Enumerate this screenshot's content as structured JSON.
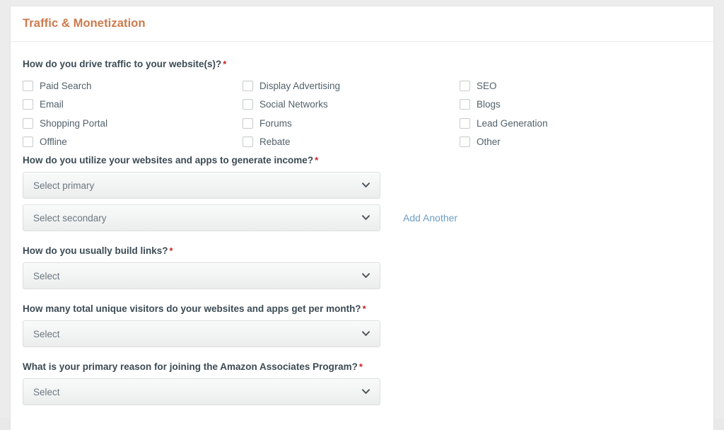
{
  "card": {
    "title": "Traffic & Monetization"
  },
  "colors": {
    "title": "#cc7a4c",
    "label": "#3c4b54",
    "required": "#cc2121",
    "link": "#6d9dc3",
    "select_text": "#6b7880",
    "page_background": "#ececed",
    "card_background": "#ffffff"
  },
  "required_marker": "*",
  "fields": {
    "traffic": {
      "label": "How do you drive traffic to your website(s)?",
      "required": true,
      "type": "checkbox-group",
      "columns": [
        [
          {
            "label": "Paid Search",
            "checked": false
          },
          {
            "label": "Email",
            "checked": false
          },
          {
            "label": "Shopping Portal",
            "checked": false
          },
          {
            "label": "Offline",
            "checked": false
          }
        ],
        [
          {
            "label": "Display Advertising",
            "checked": false
          },
          {
            "label": "Social Networks",
            "checked": false
          },
          {
            "label": "Forums",
            "checked": false
          },
          {
            "label": "Rebate",
            "checked": false
          }
        ],
        [
          {
            "label": "SEO",
            "checked": false
          },
          {
            "label": "Blogs",
            "checked": false
          },
          {
            "label": "Lead Generation",
            "checked": false
          },
          {
            "label": "Other",
            "checked": false
          }
        ]
      ]
    },
    "monetization": {
      "label": "How do you utilize your websites and apps to generate income?",
      "required": true,
      "type": "select-pair",
      "primary_value": "Select primary",
      "secondary_value": "Select secondary",
      "add_another_label": "Add Another"
    },
    "links": {
      "label": "How do you usually build links?",
      "required": true,
      "type": "select",
      "value": "Select"
    },
    "visitors": {
      "label": "How many total unique visitors do your websites and apps get per month?",
      "required": true,
      "type": "select",
      "value": "Select"
    },
    "reason": {
      "label": "What is your primary reason for joining the Amazon Associates Program?",
      "required": true,
      "type": "select",
      "value": "Select"
    }
  },
  "icons": {
    "chevron_down": "chevron-down-icon",
    "checkbox": "checkbox-icon"
  }
}
